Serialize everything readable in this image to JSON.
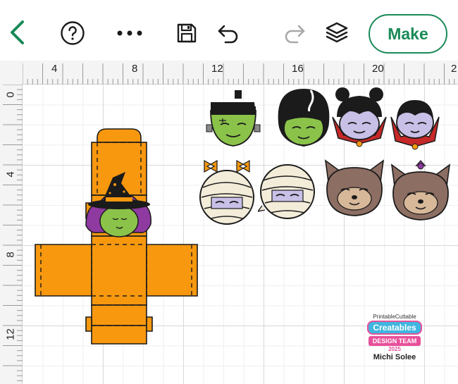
{
  "toolbar": {
    "make_label": "Make",
    "icons": [
      "back-arrow-icon",
      "help-icon",
      "more-icon",
      "save-icon",
      "undo-icon",
      "redo-icon",
      "layers-icon"
    ]
  },
  "ruler": {
    "top_labels": [
      "4",
      "8",
      "12",
      "16",
      "20",
      "2"
    ],
    "left_labels": [
      "0",
      "4",
      "8",
      "12"
    ]
  },
  "canvas": {
    "objects": [
      "witch-box-template",
      "frankenstein-face",
      "bride-face",
      "vampire-girl-face",
      "vampire-face",
      "mummy-girl-face",
      "mummy-face",
      "werewolf-face",
      "werewolf-girl-face"
    ]
  },
  "badge": {
    "top": "PrintableCuttable",
    "main": "Creatables",
    "ribbon": "DESIGN TEAM",
    "year": "2025",
    "name": "Michi Solee"
  },
  "colors": {
    "accent": "#1a8a57",
    "box_orange": "#f7980f",
    "monster_green": "#8bc34a",
    "witch_purple": "#8e3aa0"
  }
}
